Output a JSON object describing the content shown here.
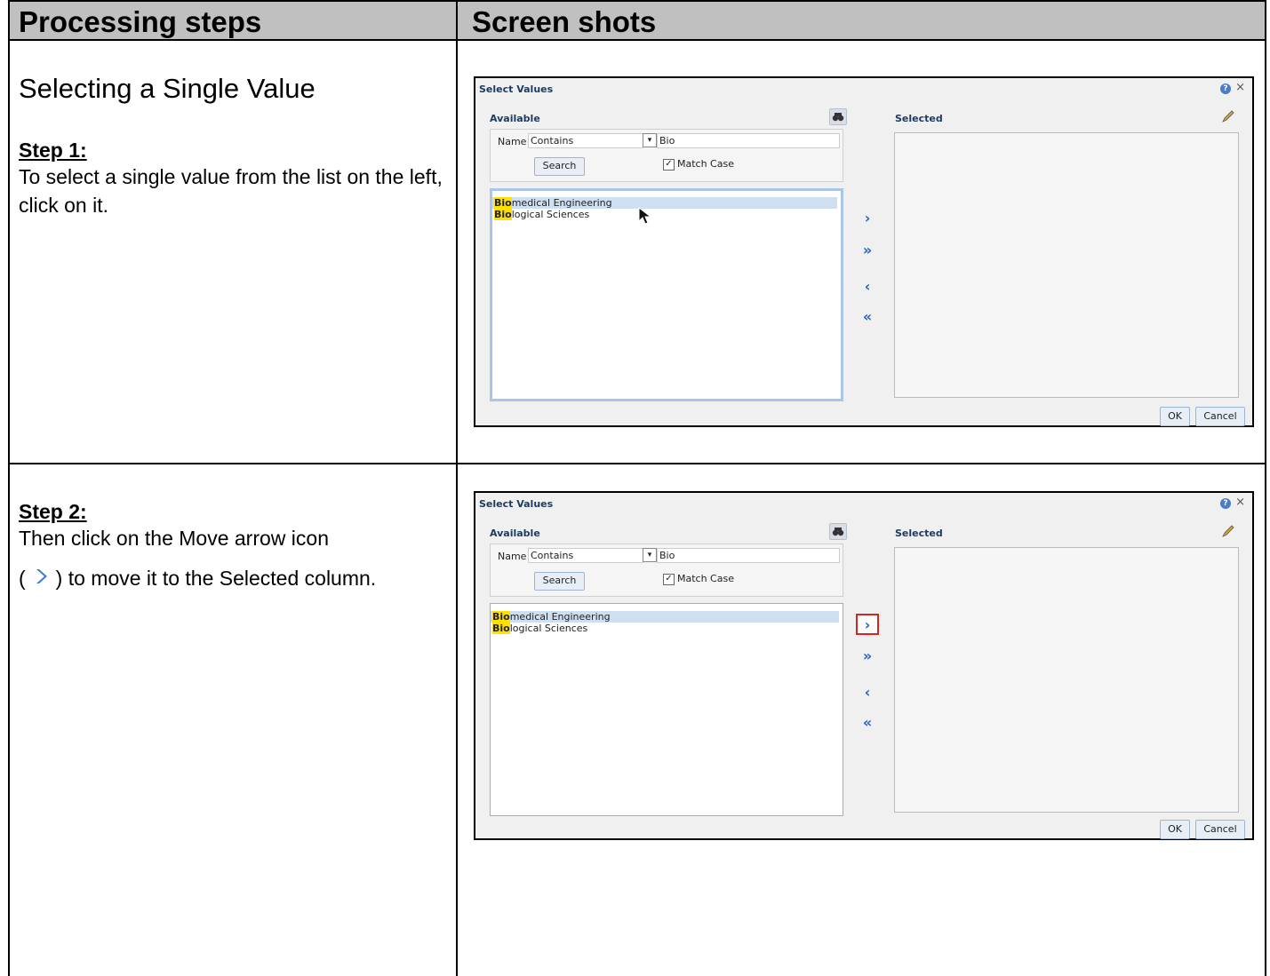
{
  "headers": {
    "col1": "Processing steps",
    "col2": "Screen shots"
  },
  "section_title": "Selecting a Single Value",
  "step1": {
    "label": "Step 1:",
    "text": "To select a single value from the list on the left, click on it."
  },
  "step2": {
    "label": "Step 2:",
    "text_before": "Then click on the Move arrow icon",
    "paren_open": "(",
    "text_after": ") to move it to the Selected column."
  },
  "dialog": {
    "title": "Select Values",
    "available_label": "Available",
    "selected_label": "Selected",
    "name_label": "Name",
    "match_value": "Contains",
    "search_term": "Bio",
    "search_button": "Search",
    "match_case_label": "Match Case",
    "match_case_checked": true,
    "items": [
      {
        "highlight": "Bio",
        "rest": "medical Engineering"
      },
      {
        "highlight": "Bio",
        "rest": "logical Sciences"
      }
    ],
    "ok_label": "OK",
    "cancel_label": "Cancel",
    "help_glyph": "?",
    "close_glyph": "×",
    "dropdown_glyph": "▾",
    "check_glyph": "✓",
    "move_glyphs": [
      "›",
      "»",
      "‹",
      "«"
    ]
  },
  "colors": {
    "header_bg": "#c0c0c0",
    "highlight": "#ffe100",
    "selection": "#cfdff2",
    "callout": "#d9261c",
    "arrow_blue": "#2b62c2"
  }
}
